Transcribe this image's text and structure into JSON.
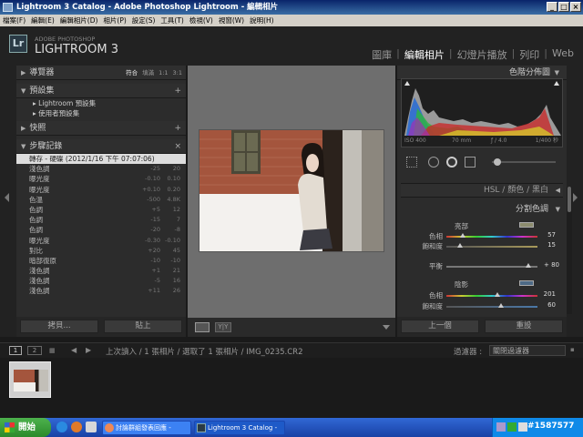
{
  "window": {
    "title": "Lightroom 3 Catalog - Adobe Photoshop Lightroom - 編輯相片"
  },
  "menu": [
    "檔案(F)",
    "編輯(E)",
    "編輯相片(D)",
    "相片(P)",
    "設定(S)",
    "工具(T)",
    "檢視(V)",
    "視窗(W)",
    "說明(H)"
  ],
  "brand": {
    "logo": "Lr",
    "line1": "ADOBE PHOTOSHOP",
    "line2": "LIGHTROOM 3"
  },
  "modules": [
    "圖庫",
    "編輯相片",
    "幻燈片播放",
    "列印",
    "Web"
  ],
  "left": {
    "navigator": {
      "label": "導覽器",
      "opts": [
        "符合",
        "填滿",
        "1:1",
        "3:1"
      ]
    },
    "presets": {
      "label": "預設集",
      "items": [
        "Lightroom 預設集",
        "使用者預設集"
      ]
    },
    "snapshots": {
      "label": "快照"
    },
    "history": {
      "label": "步驟記錄",
      "rows": [
        {
          "name": "轉存 - 硬碟 (2012/1/16 下午 07:07:06)",
          "a": "",
          "b": ""
        },
        {
          "name": "淺色調",
          "a": "-25",
          "b": "20"
        },
        {
          "name": "曝光度",
          "a": "-0.10",
          "b": "0.10"
        },
        {
          "name": "曝光度",
          "a": "+0.10",
          "b": "0.20"
        },
        {
          "name": "色溫",
          "a": "-500",
          "b": "4.8K"
        },
        {
          "name": "色調",
          "a": "+5",
          "b": "12"
        },
        {
          "name": "色調",
          "a": "-15",
          "b": "7"
        },
        {
          "name": "色調",
          "a": "-20",
          "b": "-8"
        },
        {
          "name": "曝光度",
          "a": "-0.30",
          "b": "-0.10"
        },
        {
          "name": "對比",
          "a": "+20",
          "b": "45"
        },
        {
          "name": "暗部復原",
          "a": "-10",
          "b": "-10"
        },
        {
          "name": "淺色調",
          "a": "+1",
          "b": "21"
        },
        {
          "name": "淺色調",
          "a": "-5",
          "b": "16"
        },
        {
          "name": "淺色調",
          "a": "+11",
          "b": "26"
        }
      ]
    },
    "copy": "拷貝...",
    "paste": "貼上"
  },
  "right": {
    "histogram": {
      "label": "色階分佈圖",
      "iso": "ISO 400",
      "focal": "70 mm",
      "fstop": "ƒ / 4.0",
      "shutter": "1/400 秒"
    },
    "tabs": [
      "HSL",
      "顏色",
      "黑白"
    ],
    "split": {
      "label": "分割色調",
      "highlights": "亮部",
      "hue": "色相",
      "sat": "飽和度",
      "balance": "平衡",
      "shadows": "陰影",
      "hi_hue": "57",
      "hi_sat": "15",
      "bal": "+ 80",
      "sh_hue": "201",
      "sh_sat": "60"
    },
    "prev": "上一個",
    "reset": "重設"
  },
  "filmstrip": {
    "path": "上次讀入 / 1 張相片 / 選取了 1 張相片 / IMG_0235.CR2",
    "filter_label": "過濾器 :",
    "filter_value": "關閉過濾器",
    "pages": [
      "1",
      "2"
    ]
  },
  "taskbar": {
    "start": "開始",
    "tasks": [
      "討論群組發表回應 -",
      "Lightroom 3 Catalog -"
    ],
    "watermark": "#1587577"
  }
}
